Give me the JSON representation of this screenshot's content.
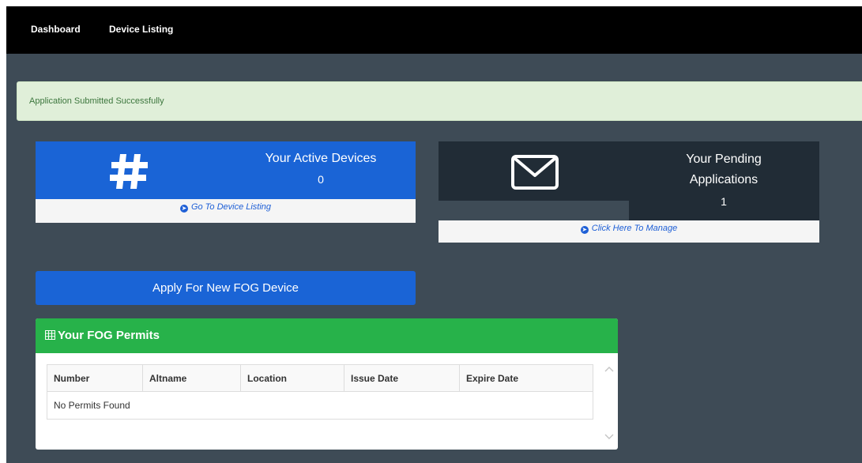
{
  "nav": {
    "items": [
      {
        "label": "Dashboard"
      },
      {
        "label": "Device Listing"
      }
    ]
  },
  "alert": {
    "message": "Application Submitted Successfully"
  },
  "active_devices": {
    "title": "Your Active Devices",
    "count": "0",
    "link": "Go To Device Listing",
    "icon": "hashtag-icon",
    "color": "#1a64d6"
  },
  "pending_applications": {
    "title_line1": "Your Pending",
    "title_line2": "Applications",
    "count": "1",
    "link": "Click Here To Manage",
    "icon": "envelope-icon",
    "color": "#212c36"
  },
  "apply_button": {
    "label": "Apply For New FOG Device"
  },
  "permits": {
    "title": "Your FOG Permits",
    "icon": "table-icon",
    "header_color": "#27b24a",
    "columns": [
      "Number",
      "Altname",
      "Location",
      "Issue Date",
      "Expire Date"
    ],
    "empty_message": "No Permits Found"
  }
}
